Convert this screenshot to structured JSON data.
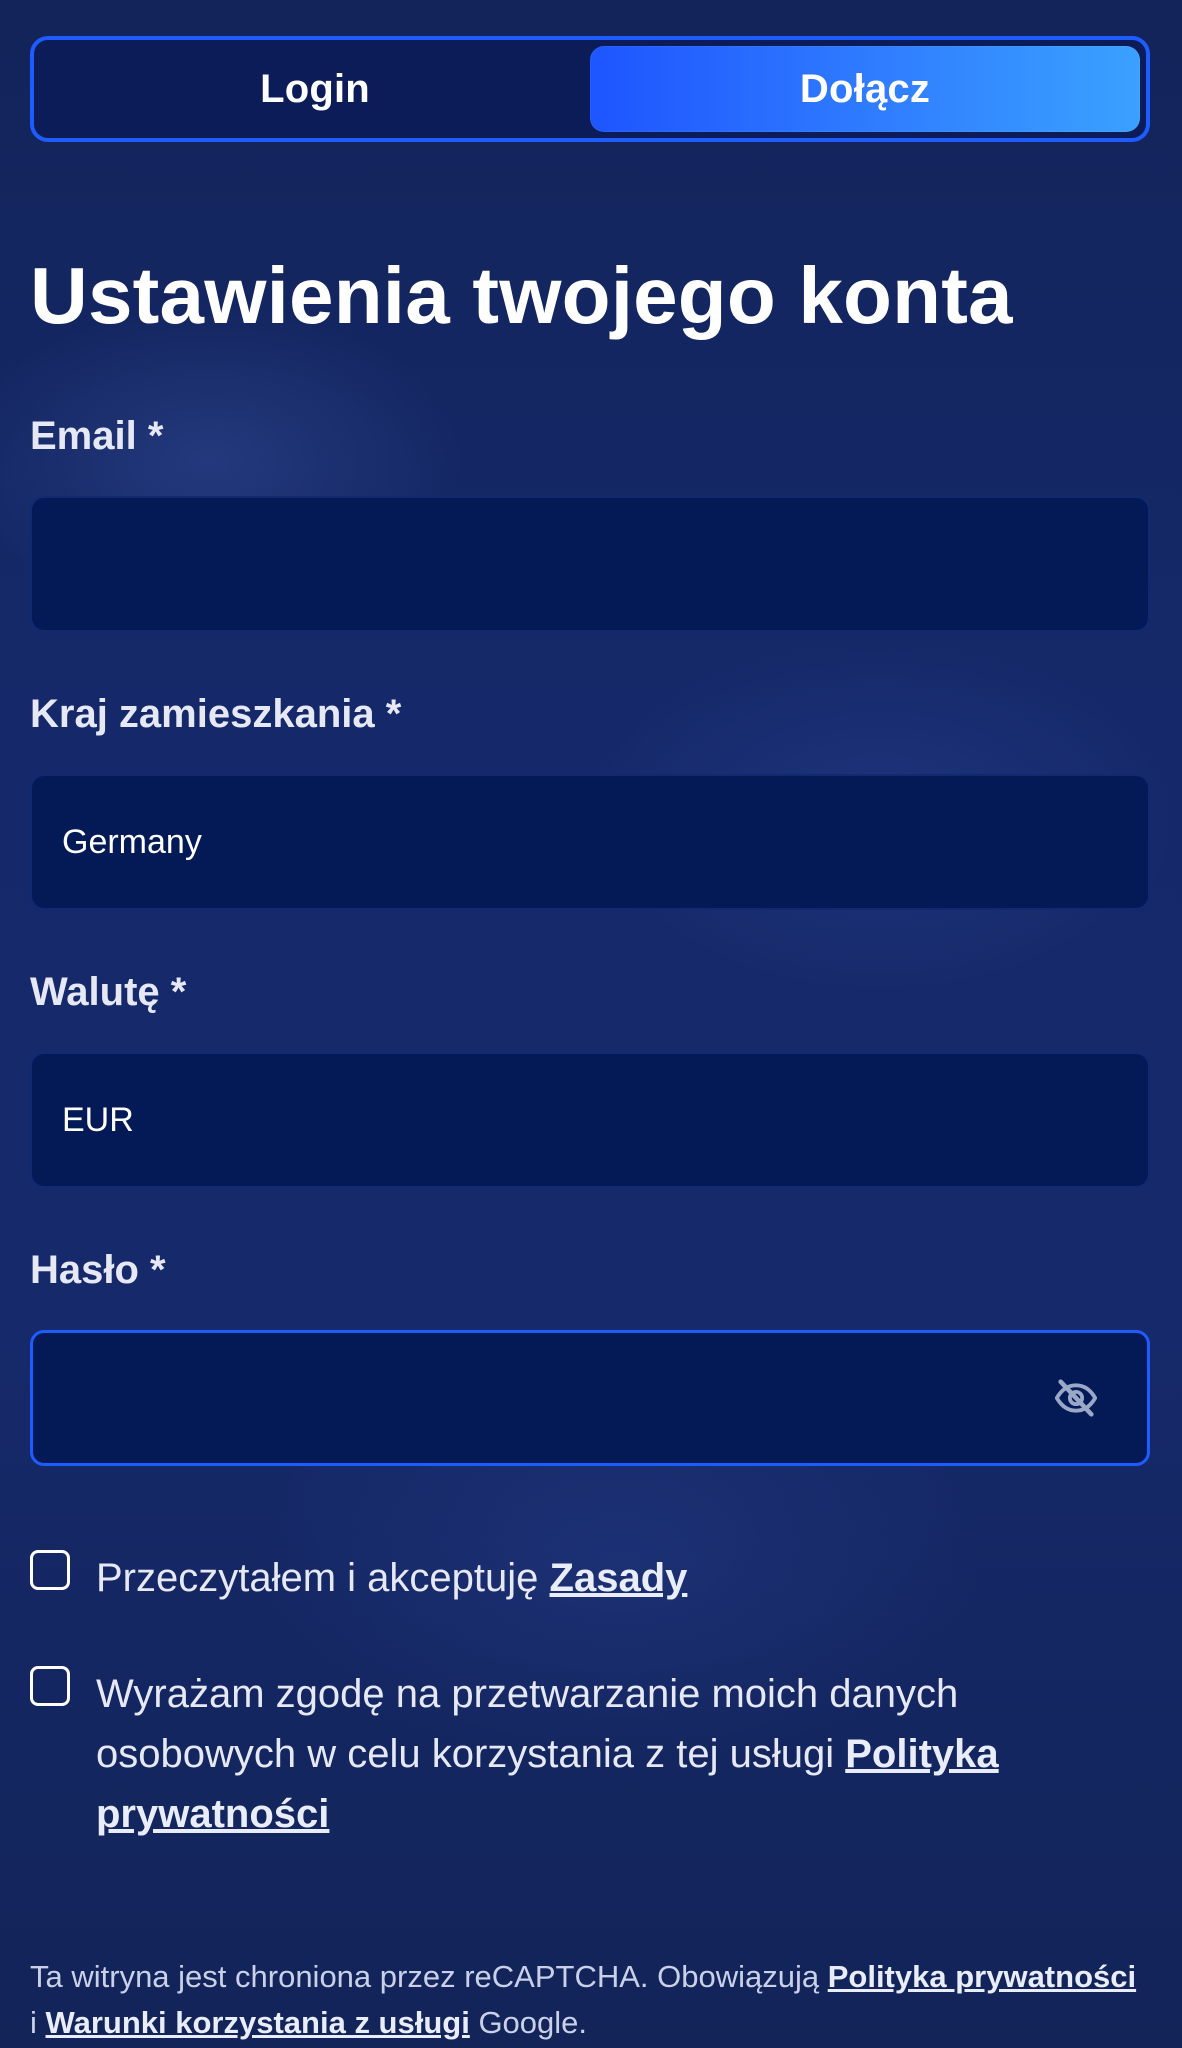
{
  "tabs": [
    {
      "label": "Login",
      "active": false
    },
    {
      "label": "Dołącz",
      "active": true
    }
  ],
  "title": "Ustawienia twojego konta",
  "fields": {
    "email": {
      "label": "Email *",
      "value": ""
    },
    "country": {
      "label": "Kraj zamieszkania *",
      "value": "Germany"
    },
    "currency": {
      "label": "Walutę *",
      "value": "EUR"
    },
    "password": {
      "label": "Hasło *",
      "value": "",
      "toggle_icon": "eye-off-icon"
    }
  },
  "consents": {
    "terms": {
      "text": "Przeczytałem i akceptuję ",
      "link": "Zasady"
    },
    "privacy": {
      "text": "Wyrażam zgodę na przetwarzanie moich danych osobowych w celu korzystania z tej usługi ",
      "link": "Polityka prywatności"
    }
  },
  "footer": {
    "text1": "Ta witryna jest chroniona przez reCAPTCHA. Obowiązują ",
    "privacy_link": "Polityka prywatności",
    "text2": " i ",
    "terms_link": "Warunki korzystania z usługi",
    "text3": " Google."
  },
  "colors": {
    "accent": "#1f5cff",
    "background": "#15296a",
    "input_bg": "#041a57"
  }
}
